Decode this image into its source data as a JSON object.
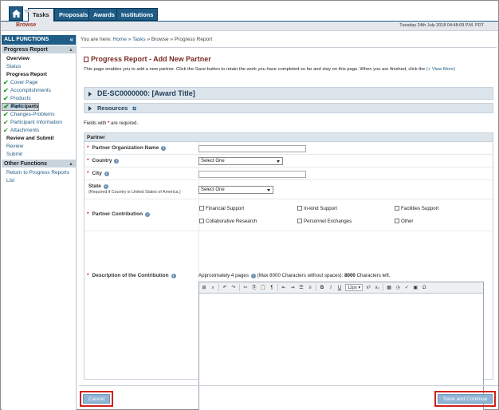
{
  "nav": {
    "tabs": [
      "Tasks",
      "Proposals",
      "Awards",
      "Institutions"
    ],
    "sub_label": "Browse",
    "date": "Tuesday 24th July 2018 04:48:09 P.M. PDT"
  },
  "sidebar": {
    "header": "ALL FUNCTIONS",
    "section1": "Progress Report",
    "items": [
      {
        "label": "Overview"
      },
      {
        "label": "Status"
      },
      {
        "label": "Progress Report"
      },
      {
        "label": "Cover Page"
      },
      {
        "label": "Accomplishments"
      },
      {
        "label": "Products"
      },
      {
        "label": "Participants"
      },
      {
        "label": "Impact"
      },
      {
        "label": "Changes-Problems"
      },
      {
        "label": "Participant Information"
      },
      {
        "label": "Attachments"
      },
      {
        "label": "Review and Submit"
      },
      {
        "label": "Review"
      },
      {
        "label": "Submit"
      }
    ],
    "section2": "Other Functions",
    "other_item": "Return to Progress Reports List"
  },
  "breadcrumb": {
    "prefix": "You are here:",
    "home": "Home",
    "tasks": "Tasks",
    "browse": "Browse",
    "current": "Progress Report"
  },
  "page": {
    "title": "Progress Report - Add New Partner",
    "intro": "This page enables you to add a new partner. Click the Save button to retain the work you have completed so far and stay on this page. When you are finished, click the",
    "view_more": "(+ View More)",
    "award_title": "DE-SC0000000: [Award Title]",
    "resources": "Resources",
    "required_note_a": "Fields with",
    "required_note_b": "are required."
  },
  "form": {
    "section": "Partner",
    "org_name_label": "Partner Organization Name",
    "country_label": "Country",
    "country_value": "Select One",
    "city_label": "City",
    "state_label": "State",
    "state_note": "(Required if Country is United States of America.)",
    "state_value": "Select One",
    "contribution_label": "Partner Contribution",
    "contribution_options": [
      "Financial Support",
      "In-kind Support",
      "Facilities Support",
      "Collaborative Research",
      "Personnel Exchanges",
      "Other"
    ],
    "description_label": "Description of the Contribution",
    "approx_a": "Approximately 4 pages",
    "approx_b": "(Max 8000 Characters without spaces):",
    "approx_count": "8000",
    "approx_c": "Characters left.",
    "font_size": "12px"
  },
  "buttons": {
    "cancel": "Cancel",
    "save_continue": "Save and Continue"
  },
  "colors": {
    "nav_blue": "#1f5c86",
    "title_red": "#7a2a22",
    "highlight_red": "#d0211b"
  }
}
